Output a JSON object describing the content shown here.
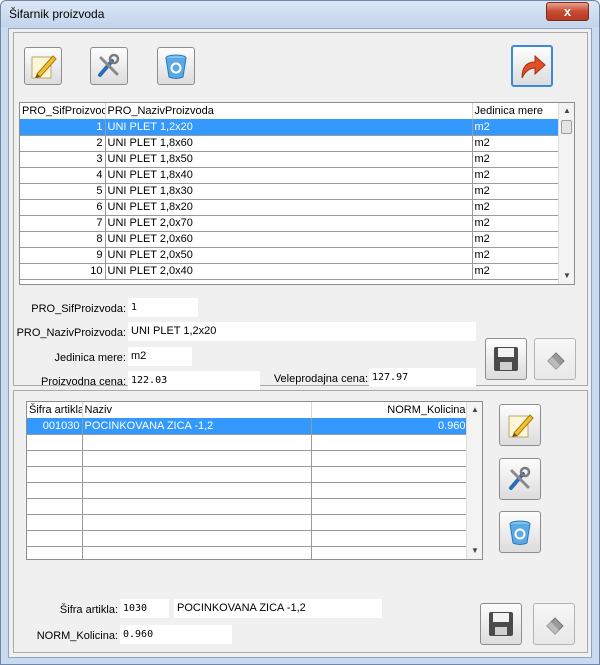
{
  "window": {
    "title": "Šifarnik proizvoda",
    "close_label": "x"
  },
  "colors": {
    "selection": "#3399ff",
    "title_bar": "#c9d9ee",
    "close_button": "#c74a32"
  },
  "icons": {
    "toolbar_top": [
      "edit-pencil-icon",
      "tools-icon",
      "recycle-bin-icon",
      "exit-arrow-icon"
    ],
    "top_form": [
      "floppy-save-icon",
      "eraser-icon"
    ],
    "bottom_side": [
      "edit-pencil-icon",
      "tools-icon",
      "recycle-bin-icon"
    ],
    "bottom_form": [
      "floppy-save-icon",
      "eraser-icon"
    ]
  },
  "products_grid": {
    "columns": [
      "PRO_SifProizvoda",
      "PRO_NazivProizvoda",
      "Jedinica mere"
    ],
    "rows": [
      {
        "id": "1",
        "name": "UNI PLET 1,2x20",
        "unit": "m2"
      },
      {
        "id": "2",
        "name": "UNI PLET 1,8x60",
        "unit": "m2"
      },
      {
        "id": "3",
        "name": "UNI PLET 1,8x50",
        "unit": "m2"
      },
      {
        "id": "4",
        "name": "UNI PLET 1,8x40",
        "unit": "m2"
      },
      {
        "id": "5",
        "name": "UNI PLET 1,8x30",
        "unit": "m2"
      },
      {
        "id": "6",
        "name": "UNI PLET 1,8x20",
        "unit": "m2"
      },
      {
        "id": "7",
        "name": "UNI PLET 2,0x70",
        "unit": "m2"
      },
      {
        "id": "8",
        "name": "UNI PLET 2,0x60",
        "unit": "m2"
      },
      {
        "id": "9",
        "name": "UNI PLET 2,0x50",
        "unit": "m2"
      },
      {
        "id": "10",
        "name": "UNI PLET 2,0x40",
        "unit": "m2"
      }
    ]
  },
  "product_form": {
    "sif_label": "PRO_SifProizvoda:",
    "sif_value": "1",
    "naziv_label": "PRO_NazivProizvoda:",
    "naziv_value": "UNI PLET 1,2x20",
    "jedinica_label": "Jedinica mere:",
    "jedinica_value": "m2",
    "proizvodna_label": "Proizvodna cena:",
    "proizvodna_value": "122.03",
    "veleprodajna_label": "Veleprodajna cena:",
    "veleprodajna_value": "127.97"
  },
  "articles_grid": {
    "columns": [
      "Šifra artikla",
      "Naziv",
      "NORM_Kolicina"
    ],
    "rows": [
      {
        "sifra": "001030",
        "naziv": "POCINKOVANA ZICA -1,2",
        "kolicina": "0.960"
      }
    ]
  },
  "article_form": {
    "sifra_label": "Šifra artikla:",
    "sifra_value": "1030",
    "naziv_value": "POCINKOVANA ZICA -1,2",
    "kolicina_label": "NORM_Kolicina:",
    "kolicina_value": "0.960"
  }
}
